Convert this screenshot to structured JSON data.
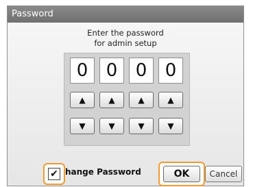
{
  "window": {
    "title": "Password"
  },
  "prompt": {
    "line1": "Enter the password",
    "line2": "for admin setup"
  },
  "digits": [
    "0",
    "0",
    "0",
    "0"
  ],
  "icons": {
    "up": "▲",
    "down": "▼",
    "check": "✔"
  },
  "change_password": {
    "label": "hange Password",
    "checked": true
  },
  "buttons": {
    "ok": "OK",
    "cancel": "Cancel"
  },
  "colors": {
    "highlight": "#f29a2e",
    "titlebar": "#7a7a7a"
  }
}
